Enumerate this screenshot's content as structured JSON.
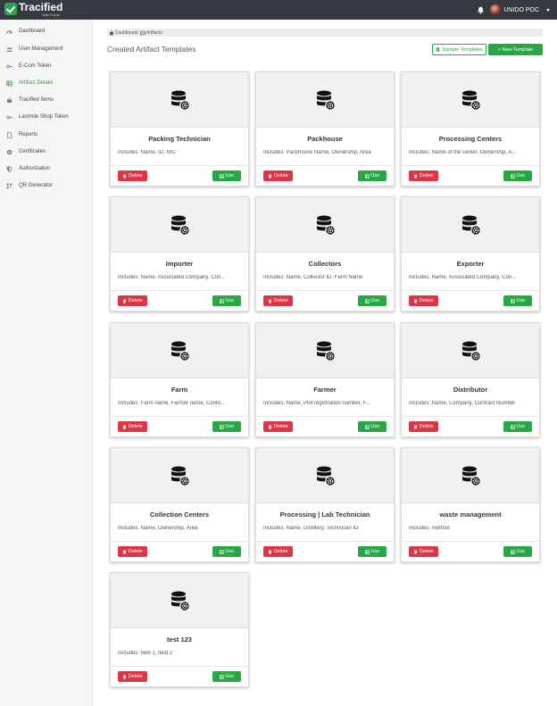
{
  "header": {
    "logo_title": "Tracified",
    "logo_subtitle": "Web Portal",
    "user_name": "UNIDO POC",
    "icons": [
      "bell-icon",
      "avatar",
      "caret-down-icon"
    ]
  },
  "sidebar": {
    "items": [
      {
        "label": "Dashboard",
        "icon": "dashboard-icon"
      },
      {
        "label": "User Management",
        "icon": "users-icon"
      },
      {
        "label": "E-Com Token",
        "icon": "key-icon"
      },
      {
        "label": "Artifact Details",
        "icon": "table-icon",
        "active": true
      },
      {
        "label": "Tracified Items",
        "icon": "shopping-basket-icon"
      },
      {
        "label": "Lastmile Shop Token",
        "icon": "key-icon"
      },
      {
        "label": "Reports",
        "icon": "file-icon"
      },
      {
        "label": "Certificates",
        "icon": "certificate-icon"
      },
      {
        "label": "Authorization",
        "icon": "shield-icon"
      },
      {
        "label": "QR Generator",
        "icon": "qrcode-icon"
      }
    ]
  },
  "breadcrumb": {
    "home": "Dashboard",
    "separator": "/",
    "current": "Artifacts"
  },
  "main": {
    "title": "Created Artifact Templates",
    "sample_button": "Sample Templates",
    "new_button": "+ New Template"
  },
  "cards": [
    {
      "title": "Packing Technician",
      "includes": "Includes: Name, ID, NIC"
    },
    {
      "title": "Packhouse",
      "includes": "Includes: Packhouse Name, Ownership, Area"
    },
    {
      "title": "Processing Centers",
      "includes": "Includes: Name of the center, Ownership, A..."
    },
    {
      "title": "Importer",
      "includes": "Includes: Name, Associated Company, Con..."
    },
    {
      "title": "Collectors",
      "includes": "Includes: Name, Collector ID, Farm Name"
    },
    {
      "title": "Exporter",
      "includes": "Includes: Name, Associated Company, Con..."
    },
    {
      "title": "Farm",
      "includes": "Includes: Farm name, Farmer name, Conto..."
    },
    {
      "title": "Farmer",
      "includes": "Includes: Name, Plot registration number, F..."
    },
    {
      "title": "Distributor",
      "includes": "Includes: Name, Company, Contract Number"
    },
    {
      "title": "Collection Centers",
      "includes": "Includes: Name, Ownership, Area"
    },
    {
      "title": "Processing | Lab Technician",
      "includes": "Includes: Name, Distillery, Technician ID"
    },
    {
      "title": "waste management",
      "includes": "Includes: method"
    },
    {
      "title": "test 123",
      "includes": "Includes: field 1, field 2"
    }
  ],
  "card_actions": {
    "delete_label": "Delete",
    "use_label": "Use"
  },
  "colors": {
    "topbar": "#363a40",
    "accent_green": "#28a745",
    "danger_red": "#dc3545",
    "active_sidebar": "#2f9e44"
  }
}
